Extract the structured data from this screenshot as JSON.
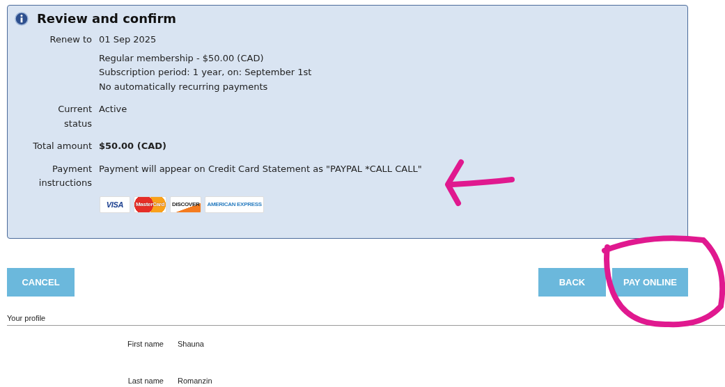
{
  "panel": {
    "title": "Review and confirm",
    "rows": [
      {
        "label": "Renew to",
        "values": [
          "01 Sep 2025"
        ],
        "notes": [
          "Regular membership - $50.00 (CAD)",
          "Subscription period: 1 year, on: September 1st",
          "No automatically recurring payments"
        ],
        "bold": false
      },
      {
        "label": "Current status",
        "values": [
          "Active"
        ],
        "bold": false
      },
      {
        "label": "Total amount",
        "values": [
          "$50.00 (CAD)"
        ],
        "bold": true
      },
      {
        "label": "Payment instructions",
        "values": [
          "Payment will appear on Credit Card Statement as \"PAYPAL *CALL CALL\""
        ],
        "bold": false
      }
    ],
    "cards": [
      {
        "kind": "visa",
        "text": "VISA"
      },
      {
        "kind": "mastercard",
        "text": "MasterCard"
      },
      {
        "kind": "discover",
        "text": "DISCOVER"
      },
      {
        "kind": "amex",
        "text": "AMERICAN EXPRESS"
      }
    ]
  },
  "buttons": {
    "left": [
      "CANCEL"
    ],
    "right": [
      "BACK",
      "PAY ONLINE"
    ]
  },
  "profile": {
    "heading": "Your profile",
    "fields": [
      {
        "label": "First name",
        "value": "Shauna"
      },
      {
        "label": "Last name",
        "value": "Romanzin"
      }
    ]
  }
}
